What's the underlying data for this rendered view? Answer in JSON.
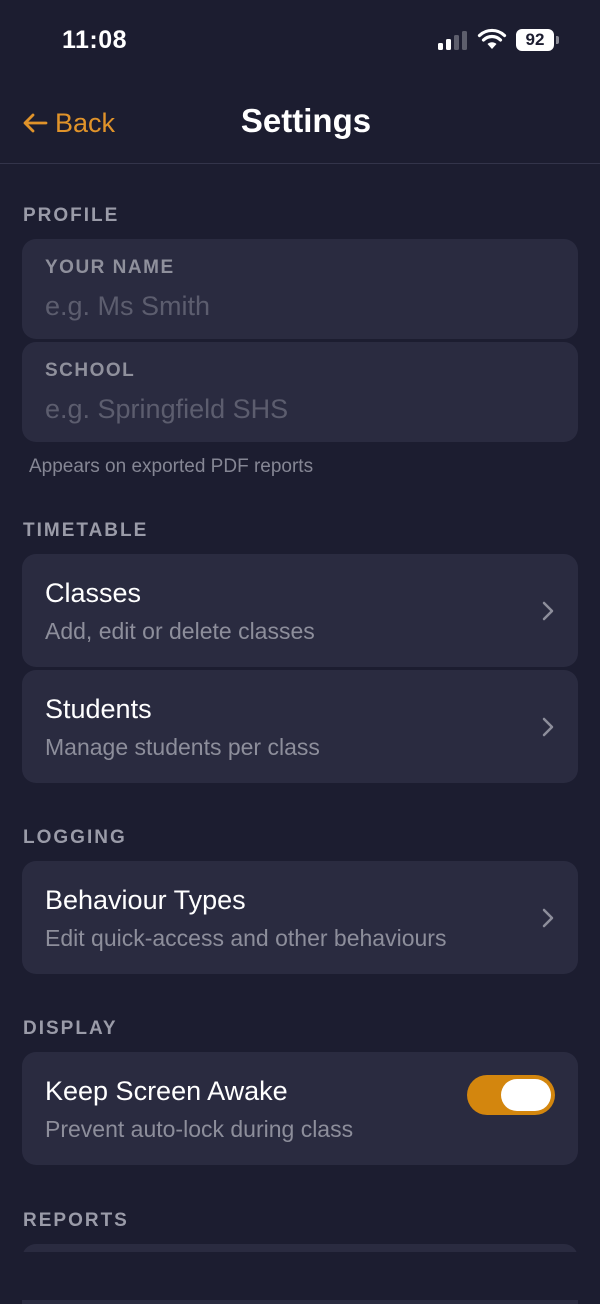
{
  "status_bar": {
    "time": "11:08",
    "battery": "92"
  },
  "nav": {
    "back_label": "Back",
    "title": "Settings"
  },
  "profile": {
    "header": "PROFILE",
    "name_label": "YOUR NAME",
    "name_placeholder": "e.g. Ms Smith",
    "school_label": "SCHOOL",
    "school_placeholder": "e.g. Springfield SHS",
    "footnote": "Appears on exported PDF reports"
  },
  "timetable": {
    "header": "TIMETABLE",
    "classes": {
      "title": "Classes",
      "subtitle": "Add, edit or delete classes"
    },
    "students": {
      "title": "Students",
      "subtitle": "Manage students per class"
    }
  },
  "logging": {
    "header": "LOGGING",
    "behaviour_types": {
      "title": "Behaviour Types",
      "subtitle": "Edit quick-access and other behaviours"
    }
  },
  "display": {
    "header": "DISPLAY",
    "keep_awake": {
      "title": "Keep Screen Awake",
      "subtitle": "Prevent auto-lock during class",
      "enabled": true
    }
  },
  "reports": {
    "header": "REPORTS"
  },
  "colors": {
    "background": "#1c1d30",
    "card": "#2a2b40",
    "accent": "#e0932a",
    "toggle_on": "#d3860e"
  },
  "icons": [
    "back-arrow-icon",
    "chevron-right-icon",
    "wifi-icon",
    "signal-icon",
    "battery-icon"
  ]
}
